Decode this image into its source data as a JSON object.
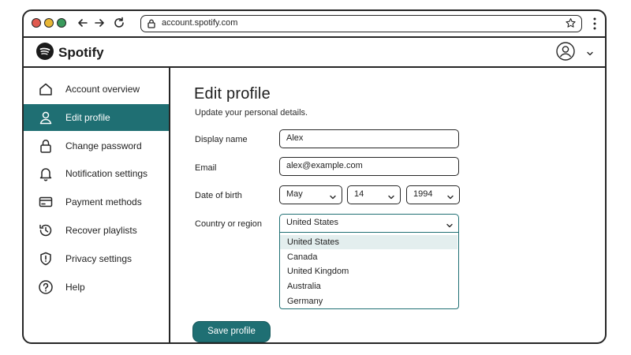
{
  "browser": {
    "url": "account.spotify.com"
  },
  "header": {
    "brand": "Spotify"
  },
  "sidebar": {
    "items": [
      {
        "label": "Account overview",
        "icon": "home-icon"
      },
      {
        "label": "Edit profile",
        "icon": "user-icon",
        "active": true
      },
      {
        "label": "Change password",
        "icon": "lock-icon"
      },
      {
        "label": "Notification settings",
        "icon": "bell-icon"
      },
      {
        "label": "Payment methods",
        "icon": "credit-card-icon"
      },
      {
        "label": "Recover playlists",
        "icon": "history-icon"
      },
      {
        "label": "Privacy settings",
        "icon": "shield-icon"
      },
      {
        "label": "Help",
        "icon": "help-icon"
      }
    ]
  },
  "main": {
    "title": "Edit profile",
    "subtitle": "Update your personal details.",
    "fields": {
      "display_name": {
        "label": "Display name",
        "value": "Alex"
      },
      "email": {
        "label": "Email",
        "value": "alex@example.com"
      },
      "dob": {
        "label": "Date of birth",
        "month": "May",
        "day": "14",
        "year": "1994"
      },
      "country": {
        "label": "Country or region",
        "value": "United States",
        "options": [
          "United States",
          "Canada",
          "United Kingdom",
          "Australia",
          "Germany"
        ]
      }
    },
    "save_label": "Save profile"
  },
  "colors": {
    "accent": "#1f6f73",
    "selected_option": "#e3eeee",
    "outline": "#262626"
  }
}
